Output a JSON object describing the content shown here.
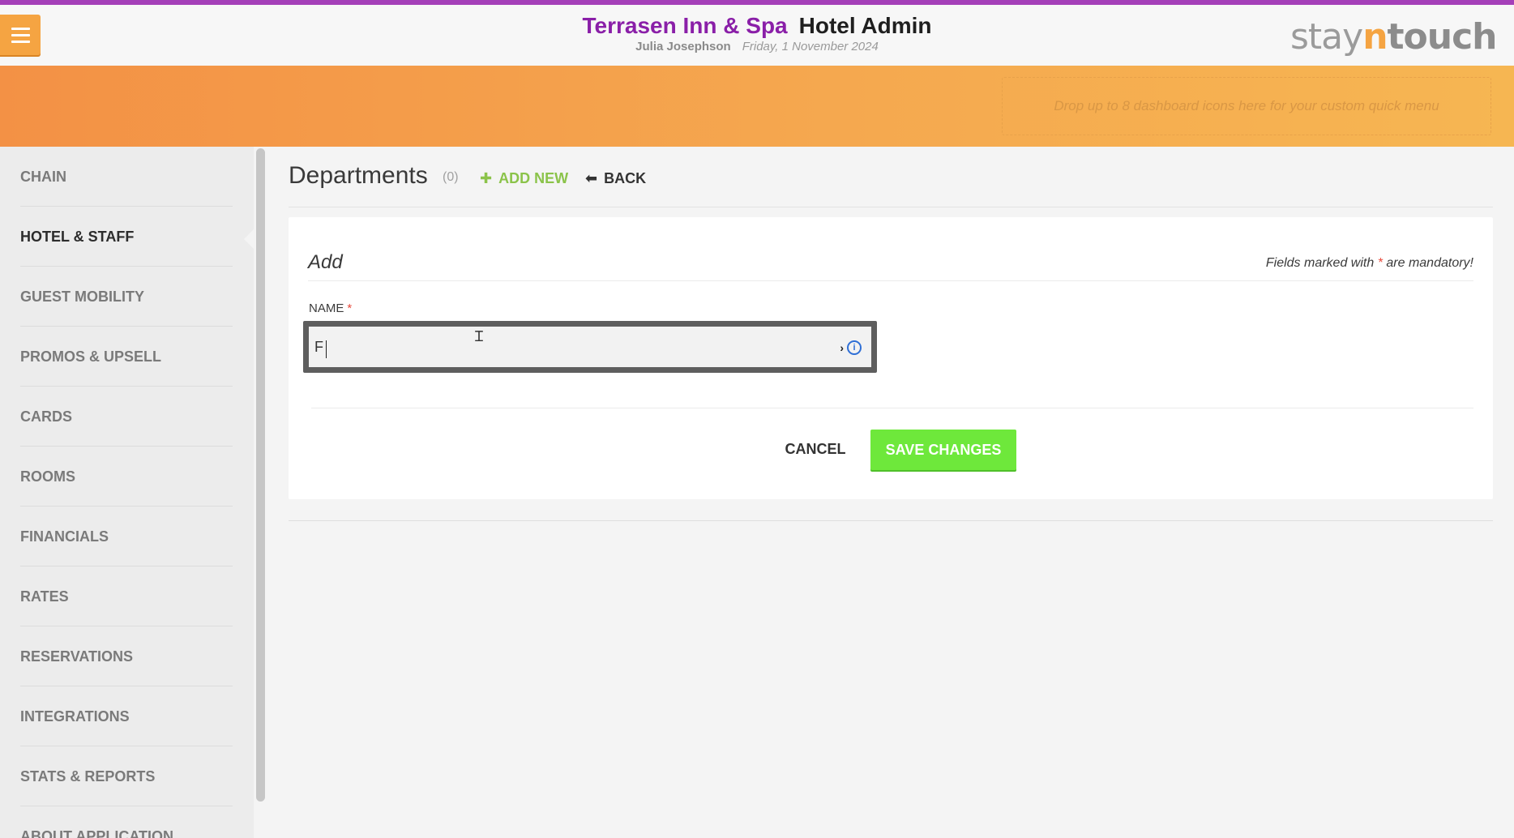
{
  "header": {
    "hotel_name": "Terrasen Inn & Spa",
    "app_name": "Hotel Admin",
    "user_name": "Julia Josephson",
    "date": "Friday, 1 November 2024",
    "logo": {
      "part1": "stay",
      "part2": "n",
      "part3": "touch"
    },
    "menu_icon": "hamburger-menu-icon"
  },
  "quick_menu": {
    "drop_hint": "Drop up to 8 dashboard icons here for your custom quick menu"
  },
  "sidebar": {
    "items": [
      {
        "label": "CHAIN"
      },
      {
        "label": "HOTEL & STAFF",
        "active": true
      },
      {
        "label": "GUEST MOBILITY"
      },
      {
        "label": "PROMOS & UPSELL"
      },
      {
        "label": "CARDS"
      },
      {
        "label": "ROOMS"
      },
      {
        "label": "FINANCIALS"
      },
      {
        "label": "RATES"
      },
      {
        "label": "RESERVATIONS"
      },
      {
        "label": "INTEGRATIONS"
      },
      {
        "label": "STATS & REPORTS"
      },
      {
        "label": "ABOUT APPLICATION"
      }
    ]
  },
  "page": {
    "title": "Departments",
    "count": "(0)",
    "add_new_label": "ADD NEW",
    "back_label": "BACK"
  },
  "form": {
    "title": "Add",
    "mandatory_prefix": "Fields marked with ",
    "mandatory_star": "*",
    "mandatory_suffix": " are mandatory!",
    "name_label": "NAME",
    "name_star": "*",
    "name_value": "F",
    "cancel_label": "CANCEL",
    "save_label": "SAVE CHANGES"
  },
  "colors": {
    "accent_purple": "#8a1fa8",
    "accent_orange": "#f5a442",
    "save_green": "#6ee83b",
    "add_green": "#8bc34a"
  }
}
